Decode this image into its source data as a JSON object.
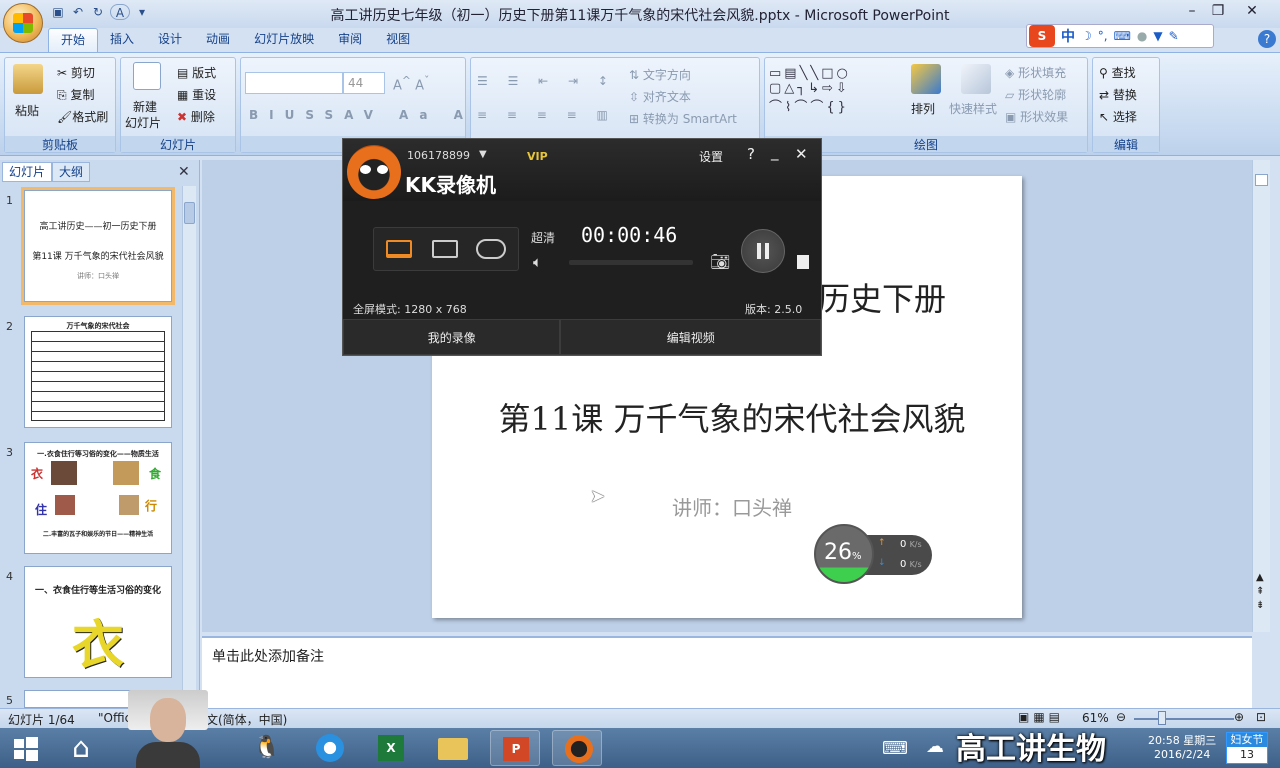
{
  "window": {
    "title": "高工讲历史七年级（初一）历史下册第11课万千气象的宋代社会风貌.pptx - Microsoft PowerPoint"
  },
  "ribbon": {
    "tabs": [
      "开始",
      "插入",
      "设计",
      "动画",
      "幻灯片放映",
      "审阅",
      "视图"
    ],
    "clipboard": {
      "paste": "粘贴",
      "cut": "剪切",
      "copy": "复制",
      "format_painter": "格式刷",
      "label": "剪贴板"
    },
    "slides": {
      "new_slide": "新建\n幻灯片",
      "new_slide_l1": "新建",
      "new_slide_l2": "幻灯片",
      "layout": "版式",
      "reset": "重设",
      "delete": "删除",
      "label": "幻灯片"
    },
    "font": {
      "size": "44",
      "label": "字"
    },
    "paragraph": {
      "text_direction": "文字方向",
      "align_text": "对齐文本",
      "smartart": "转换为 SmartArt"
    },
    "drawing": {
      "arrange": "排列",
      "quick_styles": "快速样式",
      "shape_fill": "形状填充",
      "shape_outline": "形状轮廓",
      "shape_effects": "形状效果",
      "label": "绘图"
    },
    "editing": {
      "find": "查找",
      "replace": "替换",
      "select": "选择",
      "label": "编辑"
    }
  },
  "sogou": {
    "lang": "中"
  },
  "sidebar": {
    "tabs": [
      "幻灯片",
      "大纲"
    ],
    "slides": [
      {
        "num": "1",
        "line1": "高工讲历史——初一历史下册",
        "line2": "第11课 万千气象的宋代社会风貌",
        "line3": "讲师：口头禅"
      },
      {
        "num": "2",
        "header": "万千气象的宋代社会"
      },
      {
        "num": "3",
        "line1": "一.衣食住行等习俗的变化——物质生活",
        "c1": "衣",
        "c2": "食",
        "c3": "住",
        "c4": "行",
        "line2": "二.丰富的瓦子和娱乐的节日——精神生活"
      },
      {
        "num": "4",
        "line1": "一、衣食住行等生活习俗的变化",
        "big": "衣"
      },
      {
        "num": "5"
      }
    ]
  },
  "slide": {
    "title_partial": "历史下册",
    "subtitle": "第11课 万千气象的宋代社会风貌",
    "lecturer": "讲师：口头禅"
  },
  "notes": {
    "placeholder": "单击此处添加备注"
  },
  "status": {
    "slide_pos": "幻灯片 1/64",
    "theme": "\"Offic",
    "lang": "文(简体，中国)",
    "zoom": "61%"
  },
  "kk": {
    "account": "106178899",
    "vip": "VIP",
    "name": "KK录像机",
    "settings": "设置",
    "quality": "超清",
    "timer": "00:00:46",
    "fullscreen": "全屏模式: 1280 x 768",
    "version": "版本: 2.5.0",
    "my_recordings": "我的录像",
    "edit_video": "编辑视频"
  },
  "net_widget": {
    "percent": "26",
    "pct_sign": "%",
    "up": "0",
    "down": "0",
    "unit": "K/s"
  },
  "taskbar": {
    "time": "20:58 星期三",
    "date": "2016/2/24",
    "holiday": "妇女节",
    "holiday_days": "13"
  },
  "watermark": "高工讲生物"
}
